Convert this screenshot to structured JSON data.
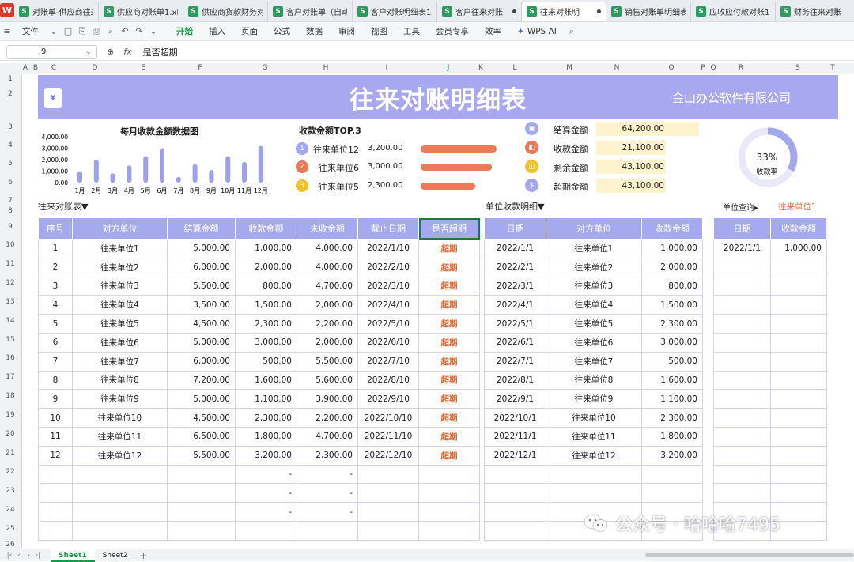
{
  "file_tabs": [
    {
      "name": "对账单-供应商往来"
    },
    {
      "name": "供应商对账单1.xlsx"
    },
    {
      "name": "供应商货款财务对账"
    },
    {
      "name": "客户对账单（自动"
    },
    {
      "name": "客户对账明细表1.xl"
    },
    {
      "name": "客户往来对账",
      "dot": true
    },
    {
      "name": "往来对账明",
      "active": true,
      "dot": true
    },
    {
      "name": "销售对账单明细表1"
    },
    {
      "name": "应收应付款对账1"
    },
    {
      "name": "财务往来对账"
    }
  ],
  "menu": {
    "file_label": "文件",
    "items": [
      "开始",
      "插入",
      "页面",
      "公式",
      "数据",
      "审阅",
      "视图",
      "工具",
      "会员专享",
      "效率"
    ],
    "active": "开始",
    "ai_label": "WPS AI"
  },
  "formula_bar": {
    "cell_ref": "J9",
    "fx": "fx",
    "content": "是否超期"
  },
  "col_headers": [
    "A",
    "B",
    "C",
    "D",
    "E",
    "F",
    "G",
    "H",
    "I",
    "J",
    "K",
    "L",
    "M",
    "N",
    "O",
    "P",
    "Q",
    "R",
    "S",
    "T"
  ],
  "row_headers": [
    "1",
    "2",
    "3",
    "4",
    "5",
    "6",
    "7",
    "8",
    "9",
    "10",
    "11",
    "12",
    "13",
    "14",
    "15",
    "16",
    "17",
    "18",
    "19",
    "20",
    "21",
    "22",
    "23",
    "24",
    "25",
    "26"
  ],
  "banner": {
    "title": "往来对账明细表",
    "company": "金山办公软件有限公司",
    "icon": "¥"
  },
  "chart_data": {
    "type": "bar",
    "title": "每月收款金额数据图",
    "categories": [
      "1月",
      "2月",
      "3月",
      "4月",
      "5月",
      "6月",
      "7月",
      "8月",
      "9月",
      "10月",
      "11月",
      "12月"
    ],
    "values": [
      1000,
      2000,
      800,
      1500,
      2300,
      3000,
      500,
      1600,
      1100,
      2300,
      1800,
      3200
    ],
    "yticks": [
      "4,000.00",
      "3,000.00",
      "2,000.00",
      "1,000.00",
      "0.00"
    ],
    "ylim": [
      0,
      4000
    ],
    "color": "#9ea0ee"
  },
  "top3": {
    "title": "收款金额TOP.3",
    "items": [
      {
        "rank": "1",
        "name": "往来单位12",
        "amount": "3,200.00",
        "color": "#a3a7ee"
      },
      {
        "rank": "2",
        "name": "往来单位6",
        "amount": "3,000.00",
        "color": "#ec7a58"
      },
      {
        "rank": "3",
        "name": "往来单位5",
        "amount": "2,300.00",
        "color": "#f2c12e"
      }
    ]
  },
  "summary": [
    {
      "label": "结算金额",
      "value": "64,200.00",
      "color": "#a3a7ee"
    },
    {
      "label": "收款金额",
      "value": "21,100.00",
      "color": "#ec7a58"
    },
    {
      "label": "剩余金额",
      "value": "43,100.00",
      "color": "#f2c12e"
    },
    {
      "label": "超期金额",
      "value": "43,100.00",
      "color": "#a3a7ee"
    }
  ],
  "donut": {
    "percent_text": "33%",
    "label": "收款率",
    "fraction": 0.33
  },
  "sections": {
    "main": "往来对账表▼",
    "detail": "单位收款明细▼",
    "query_label": "单位查询▸",
    "query_value": "往来单位1"
  },
  "main_table": {
    "headers": [
      "序号",
      "对方单位",
      "结算金额",
      "收款金额",
      "未收金额",
      "截止日期",
      "是否超期"
    ],
    "rows": [
      [
        "1",
        "往来单位1",
        "5,000.00",
        "1,000.00",
        "4,000.00",
        "2022/1/10",
        "超期"
      ],
      [
        "2",
        "往来单位2",
        "6,000.00",
        "2,000.00",
        "4,000.00",
        "2022/2/10",
        "超期"
      ],
      [
        "3",
        "往来单位3",
        "5,500.00",
        "800.00",
        "4,700.00",
        "2022/3/10",
        "超期"
      ],
      [
        "4",
        "往来单位4",
        "3,500.00",
        "1,500.00",
        "2,000.00",
        "2022/4/10",
        "超期"
      ],
      [
        "5",
        "往来单位5",
        "4,500.00",
        "2,300.00",
        "2,200.00",
        "2022/5/10",
        "超期"
      ],
      [
        "6",
        "往来单位6",
        "5,000.00",
        "3,000.00",
        "2,000.00",
        "2022/6/10",
        "超期"
      ],
      [
        "7",
        "往来单位7",
        "6,000.00",
        "500.00",
        "5,500.00",
        "2022/7/10",
        "超期"
      ],
      [
        "8",
        "往来单位8",
        "7,200.00",
        "1,600.00",
        "5,600.00",
        "2022/8/10",
        "超期"
      ],
      [
        "9",
        "往来单位9",
        "5,000.00",
        "1,100.00",
        "3,900.00",
        "2022/9/10",
        "超期"
      ],
      [
        "10",
        "往来单位10",
        "4,500.00",
        "2,300.00",
        "2,200.00",
        "2022/10/10",
        "超期"
      ],
      [
        "11",
        "往来单位11",
        "6,500.00",
        "1,800.00",
        "4,700.00",
        "2022/11/10",
        "超期"
      ],
      [
        "12",
        "往来单位12",
        "5,500.00",
        "3,200.00",
        "2,300.00",
        "2022/12/10",
        "超期"
      ],
      [
        "",
        "",
        "",
        "-",
        "-",
        "",
        ""
      ],
      [
        "",
        "",
        "",
        "-",
        "-",
        "",
        ""
      ],
      [
        "",
        "",
        "",
        "-",
        "-",
        "",
        ""
      ],
      [
        "",
        "",
        "",
        "",
        "",
        "",
        ""
      ]
    ]
  },
  "detail_table": {
    "headers": [
      "日期",
      "对方单位",
      "收款金额"
    ],
    "rows": [
      [
        "2022/1/1",
        "往来单位1",
        "1,000.00"
      ],
      [
        "2022/2/1",
        "往来单位2",
        "2,000.00"
      ],
      [
        "2022/3/1",
        "往来单位3",
        "800.00"
      ],
      [
        "2022/4/1",
        "往来单位4",
        "1,500.00"
      ],
      [
        "2022/5/1",
        "往来单位5",
        "2,300.00"
      ],
      [
        "2022/6/1",
        "往来单位6",
        "3,000.00"
      ],
      [
        "2022/7/1",
        "往来单位7",
        "500.00"
      ],
      [
        "2022/8/1",
        "往来单位8",
        "1,600.00"
      ],
      [
        "2022/9/1",
        "往来单位9",
        "1,100.00"
      ],
      [
        "2022/10/1",
        "往来单位10",
        "2,300.00"
      ],
      [
        "2022/11/1",
        "往来单位11",
        "1,800.00"
      ],
      [
        "2022/12/1",
        "往来单位12",
        "3,200.00"
      ],
      [
        "",
        "",
        ""
      ],
      [
        "",
        "",
        ""
      ],
      [
        "",
        "",
        ""
      ],
      [
        "",
        "",
        ""
      ]
    ]
  },
  "query_table": {
    "headers": [
      "日期",
      "收款金额"
    ],
    "rows": [
      [
        "2022/1/1",
        "1,000.00"
      ],
      [
        "",
        ""
      ],
      [
        "",
        ""
      ],
      [
        "",
        ""
      ],
      [
        "",
        ""
      ],
      [
        "",
        ""
      ],
      [
        "",
        ""
      ],
      [
        "",
        ""
      ],
      [
        "",
        ""
      ],
      [
        "",
        ""
      ],
      [
        "",
        ""
      ],
      [
        "",
        ""
      ],
      [
        "",
        ""
      ],
      [
        "",
        ""
      ],
      [
        "",
        ""
      ],
      [
        "",
        ""
      ]
    ]
  },
  "sheets": [
    "Sheet1",
    "Sheet2"
  ],
  "add_sheet": "+",
  "watermark": "公众号 · 哈哈哈7495"
}
